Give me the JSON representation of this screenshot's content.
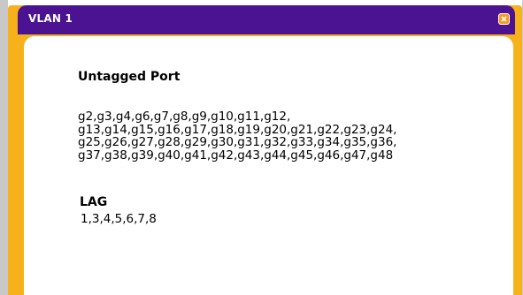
{
  "dialog": {
    "title": "VLAN 1",
    "close_icon": "close-icon",
    "colors": {
      "titlebar": "#4b1391",
      "frame": "#f6b11b",
      "close_button": "#f39a21"
    }
  },
  "untagged": {
    "heading": "Untagged Port",
    "lines": [
      "g2,g3,g4,g6,g7,g8,g9,g10,g11,g12,",
      "g13,g14,g15,g16,g17,g18,g19,g20,g21,g22,g23,g24,",
      "g25,g26,g27,g28,g29,g30,g31,g32,g33,g34,g35,g36,",
      "g37,g38,g39,g40,g41,g42,g43,g44,g45,g46,g47,g48"
    ]
  },
  "lag": {
    "heading": "LAG",
    "values": "1,3,4,5,6,7,8"
  }
}
